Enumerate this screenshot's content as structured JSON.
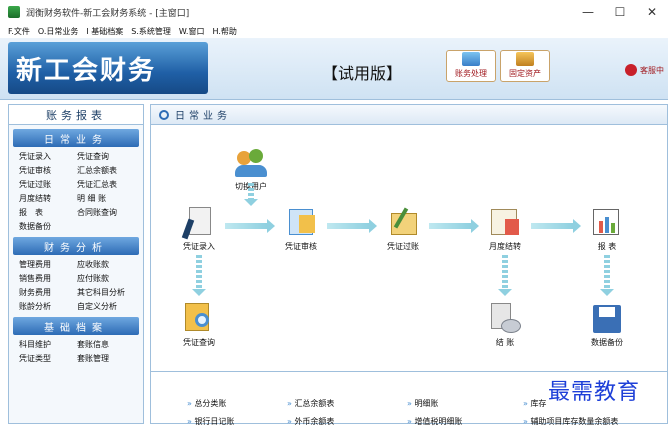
{
  "window": {
    "title": "润衡财务软件-新工会财务系统 - [主窗口]",
    "min": "—",
    "max": "☐",
    "close": "✕"
  },
  "menu": [
    "F.文件",
    "O.日常业务",
    "I 基础档案",
    "S.系统管理",
    "W.窗口",
    "H.帮助"
  ],
  "banner": {
    "brand": "新工会财务",
    "trial": "【试用版】",
    "btn1": "账务处理",
    "btn2": "固定资产",
    "service": "客服中"
  },
  "sidebar": {
    "title": "账务报表",
    "sections": [
      {
        "head": "日常业务",
        "items": [
          "凭证录入",
          "凭证查询",
          "凭证审核",
          "汇总余额表",
          "凭证过账",
          "凭证汇总表",
          "月度结转",
          "明 细 账",
          "报　表",
          "合同账查询",
          "数据备份",
          ""
        ]
      },
      {
        "head": "财务分析",
        "items": [
          "管理费用",
          "应收账款",
          "销售费用",
          "应付账款",
          "财务费用",
          "其它科目分析",
          "账龄分析",
          "自定义分析"
        ]
      },
      {
        "head": "基础档案",
        "items": [
          "科目维护",
          "套账信息",
          "凭证类型",
          "套账管理"
        ]
      }
    ]
  },
  "main": {
    "title": "日常业务",
    "flow": [
      "切换用户",
      "凭证录入",
      "凭证审核",
      "凭证过账",
      "月度结转",
      "报 表",
      "凭证查询",
      "结 账",
      "数据备份"
    ],
    "links": [
      "总分类账",
      "汇总余额表",
      "明细账",
      "库存",
      "银行日记账",
      "外币余额表",
      "增值税明细账",
      "辅助项目库存数量余额表"
    ]
  },
  "watermark": "最需教育"
}
